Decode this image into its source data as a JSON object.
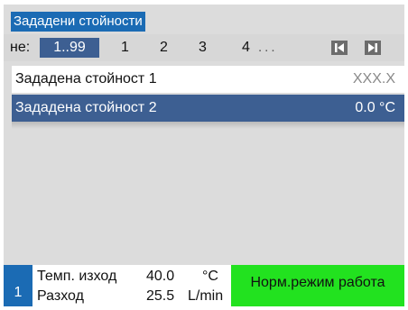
{
  "title": "Зададени стойности",
  "tabs": {
    "prefix": "не:",
    "active": "1..99",
    "items": [
      "1",
      "2",
      "3",
      "4"
    ],
    "more": "...",
    "prev_icon": "skip-back-icon",
    "next_icon": "skip-forward-icon"
  },
  "setpoints": [
    {
      "label": "Зададена стойност 1",
      "value": "XXX.X"
    },
    {
      "label": "Зададена стойност 2",
      "value": "0.0 °C"
    }
  ],
  "status": {
    "number": "1",
    "temp_label": "Темп. изход",
    "temp_value": "40.0",
    "temp_unit": "°C",
    "flow_label": "Разход",
    "flow_value": "25.5",
    "flow_unit": "L/min",
    "mode": "Норм.режим работа"
  },
  "colors": {
    "accent_blue": "#1b6bb4",
    "selection": "#3d5f92",
    "mode_green": "#22e21f",
    "background": "#dcdcdc"
  }
}
